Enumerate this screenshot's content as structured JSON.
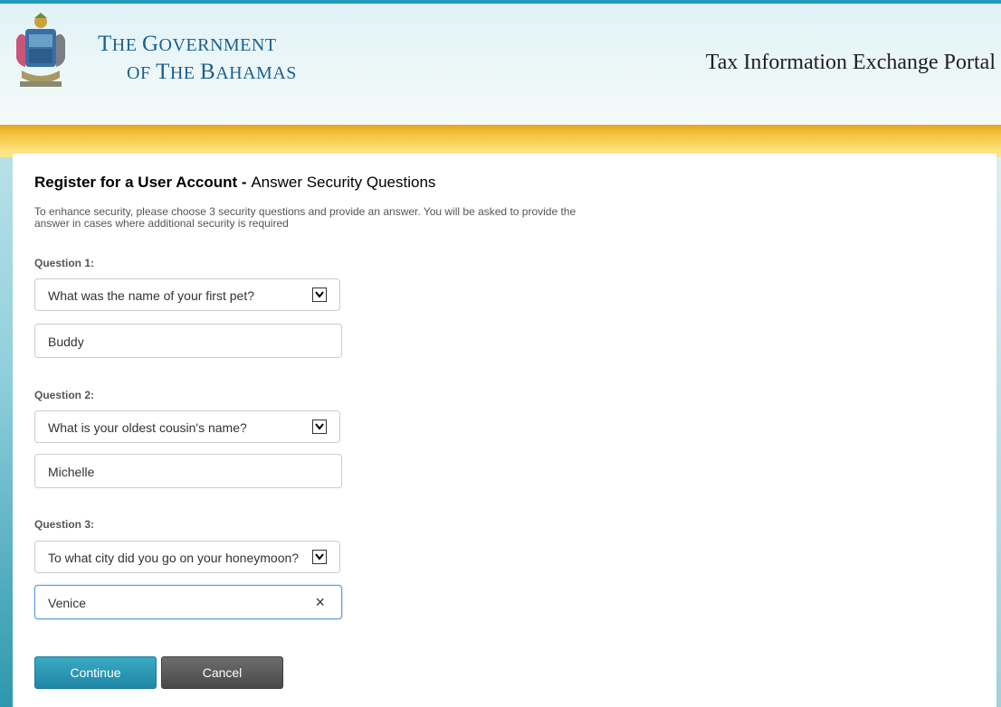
{
  "header": {
    "gov_title_line1_big1": "T",
    "gov_title_line1_small1": "HE ",
    "gov_title_line1_big2": "G",
    "gov_title_line1_small2": "OVERNMENT",
    "gov_title_line2_small1": "OF ",
    "gov_title_line2_big1": "T",
    "gov_title_line2_small2": "HE ",
    "gov_title_line2_big2": "B",
    "gov_title_line2_small3": "AHAMAS",
    "portal_title": "Tax Information Exchange Portal"
  },
  "page": {
    "title_bold": "Register for a User Account - ",
    "title_rest": "Answer Security Questions",
    "intro": "To enhance security, please choose 3 security questions and provide an answer. You will be asked to provide the answer in cases where additional security is required"
  },
  "questions": [
    {
      "label": "Question 1:",
      "selected": "What was the name of your first pet?",
      "answer": "Buddy"
    },
    {
      "label": "Question 2:",
      "selected": "What is your oldest cousin's name?",
      "answer": "Michelle"
    },
    {
      "label": "Question 3:",
      "selected": "To what city did you go on your honeymoon?",
      "answer": "Venice"
    }
  ],
  "buttons": {
    "continue": "Continue",
    "cancel": "Cancel"
  },
  "icons": {
    "clear": "×"
  },
  "colors": {
    "accent": "#1f88a6",
    "gold": "#f4c33c",
    "title_blue": "#1b5f8c"
  }
}
